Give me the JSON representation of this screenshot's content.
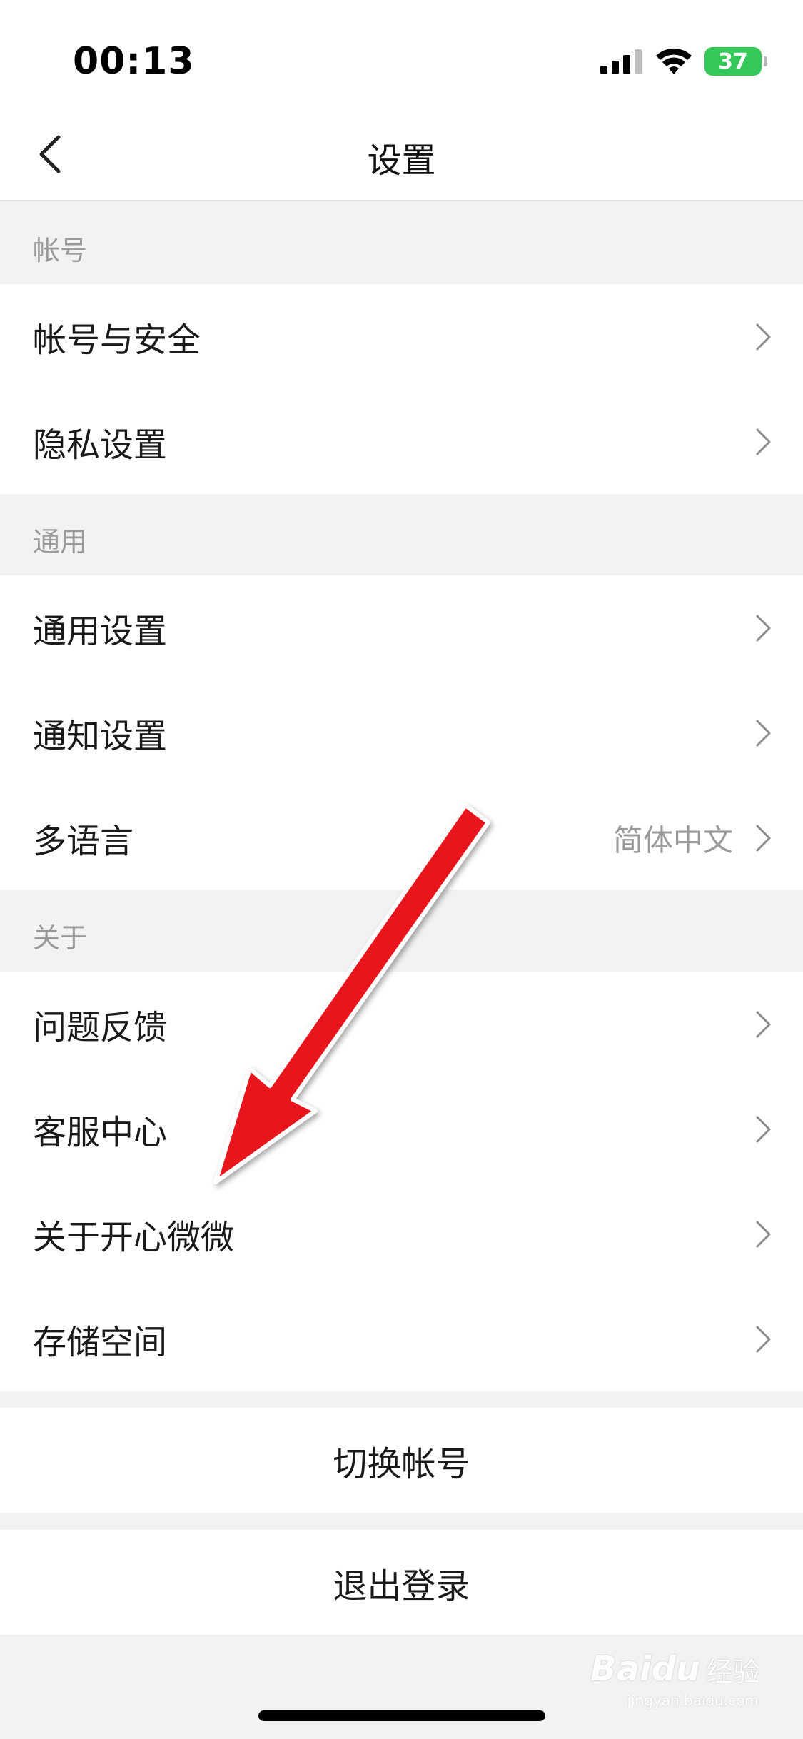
{
  "status_bar": {
    "time": "00:13",
    "battery": "37",
    "icons": [
      "cellular-signal-icon",
      "wifi-icon",
      "battery-charging-icon"
    ],
    "battery_color": "#34c759"
  },
  "nav": {
    "title": "设置",
    "back_icon": "chevron-left-icon"
  },
  "sections": {
    "account": {
      "header": "帐号",
      "items": [
        {
          "label": "帐号与安全"
        },
        {
          "label": "隐私设置"
        }
      ]
    },
    "general": {
      "header": "通用",
      "items": [
        {
          "label": "通用设置"
        },
        {
          "label": "通知设置"
        },
        {
          "label": "多语言",
          "value": "简体中文"
        }
      ]
    },
    "about": {
      "header": "关于",
      "items": [
        {
          "label": "问题反馈"
        },
        {
          "label": "客服中心"
        },
        {
          "label": "关于开心微微"
        },
        {
          "label": "存储空间"
        }
      ]
    }
  },
  "actions": {
    "switch_account": "切换帐号",
    "logout": "退出登录"
  },
  "annotation": {
    "type": "red-arrow",
    "color": "#e8151b",
    "points_to": "关于开心微微"
  },
  "watermark": {
    "logo": "Baidu",
    "text": "经验",
    "url": "jingyan.baidu.com"
  }
}
